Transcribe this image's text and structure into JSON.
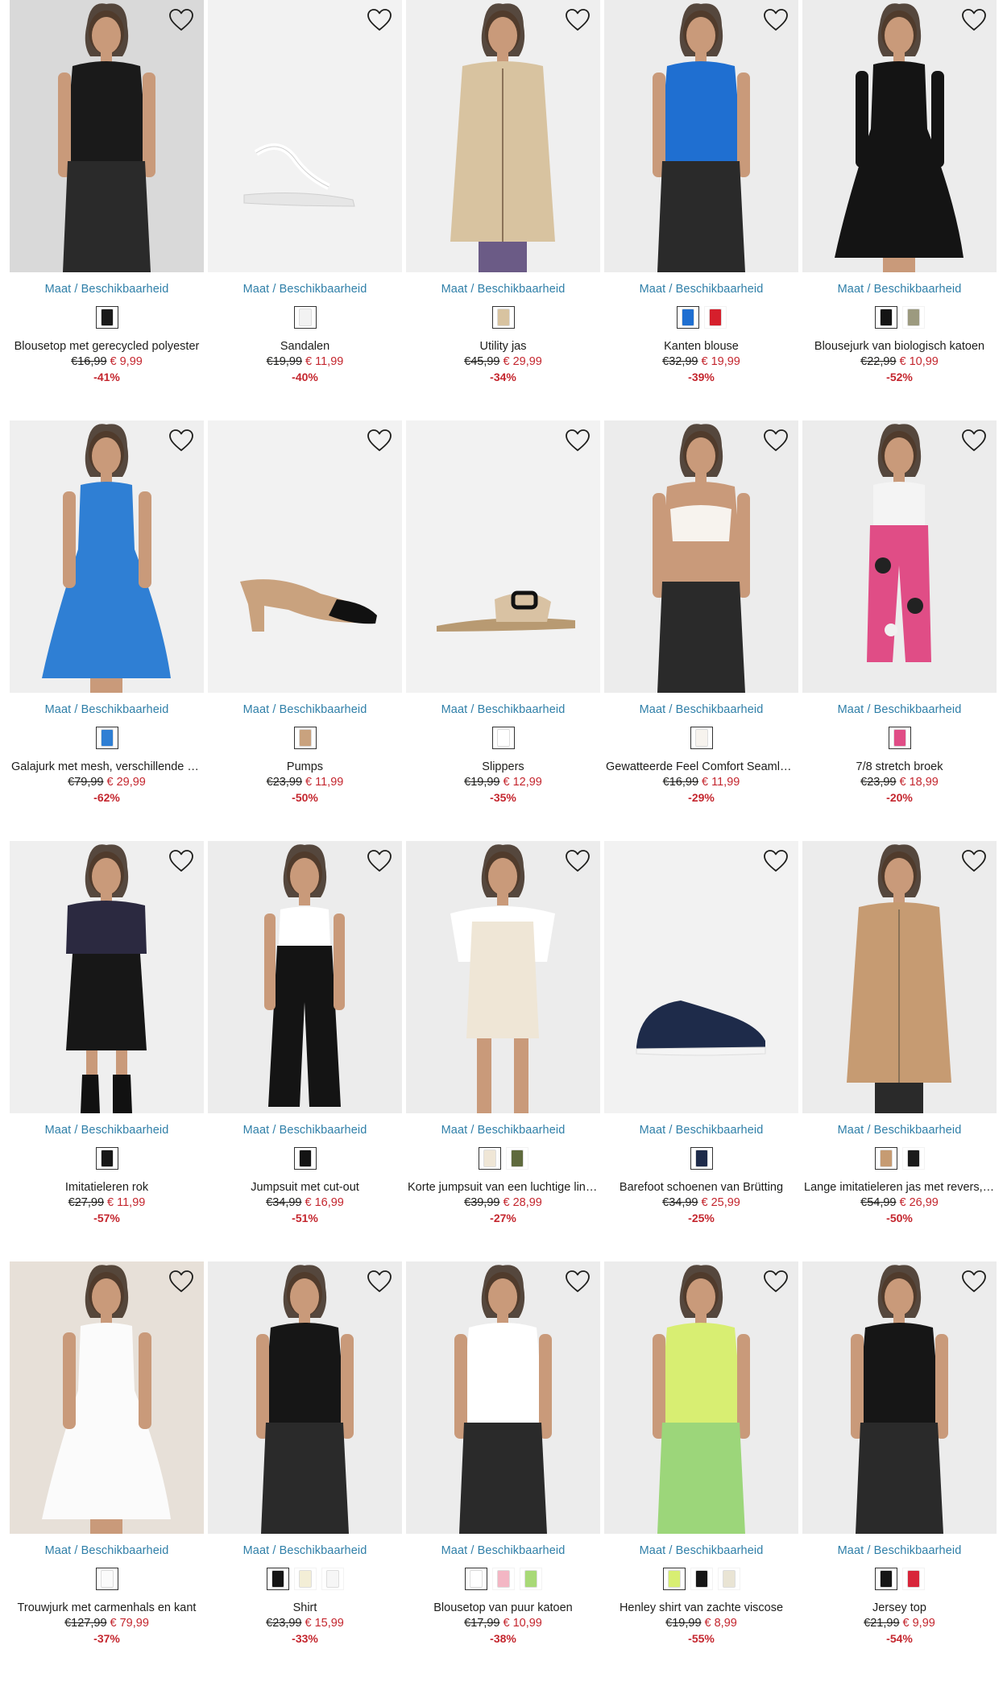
{
  "favorite_label": "♡",
  "products": [
    {
      "availability": "Maat / Beschikbaarheid",
      "name": "Blousetop met gerecycled polyester",
      "old_price": "€16,99",
      "new_price": "€ 9,99",
      "discount": "-41%",
      "bg": "#d9d9d9",
      "garment": "#1a1a1a",
      "kind": "top-model",
      "swatches": [
        "#1a1a1a"
      ]
    },
    {
      "availability": "Maat / Beschikbaarheid",
      "name": "Sandalen",
      "old_price": "€19,99",
      "new_price": "€ 11,99",
      "discount": "-40%",
      "bg": "#f2f2f2",
      "garment": "#ffffff",
      "kind": "sandal",
      "swatches": [
        "#f2f2f2"
      ]
    },
    {
      "availability": "Maat / Beschikbaarheid",
      "name": "Utility jas",
      "old_price": "€45,99",
      "new_price": "€ 29,99",
      "discount": "-34%",
      "bg": "#efefef",
      "garment": "#d8c3a0",
      "kind": "coat-model",
      "swatches": [
        "#d8c3a0"
      ]
    },
    {
      "availability": "Maat / Beschikbaarheid",
      "name": "Kanten blouse",
      "old_price": "€32,99",
      "new_price": "€ 19,99",
      "discount": "-39%",
      "bg": "#ececec",
      "garment": "#1f6fd1",
      "kind": "top-model",
      "swatches": [
        "#1f6fd1",
        "#d61f2c"
      ]
    },
    {
      "availability": "Maat / Beschikbaarheid",
      "name": "Blousejurk van biologisch katoen",
      "old_price": "€22,99",
      "new_price": "€ 10,99",
      "discount": "-52%",
      "bg": "#ececec",
      "garment": "#141414",
      "kind": "dress-model",
      "swatches": [
        "#141414",
        "#9c9a7f"
      ]
    },
    {
      "availability": "Maat / Beschikbaarheid",
      "name": "Galajurk met mesh, verschillende draagwijzen",
      "old_price": "€79,99",
      "new_price": "€ 29,99",
      "discount": "-62%",
      "bg": "#efefef",
      "garment": "#2f7fd4",
      "kind": "gown-model",
      "swatches": [
        "#2f7fd4"
      ]
    },
    {
      "availability": "Maat / Beschikbaarheid",
      "name": "Pumps",
      "old_price": "€23,99",
      "new_price": "€ 11,99",
      "discount": "-50%",
      "bg": "#f2f2f2",
      "garment": "#c9a27e",
      "kind": "pump",
      "swatches": [
        "#c9a27e"
      ]
    },
    {
      "availability": "Maat / Beschikbaarheid",
      "name": "Slippers",
      "old_price": "€19,99",
      "new_price": "€ 12,99",
      "discount": "-35%",
      "bg": "#f2f2f2",
      "garment": "#d9c2a3",
      "kind": "slipper",
      "swatches": [
        "#ffffff"
      ]
    },
    {
      "availability": "Maat / Beschikbaarheid",
      "name": "Gewatteerde Feel Comfort Seamless bralette",
      "old_price": "€16,99",
      "new_price": "€ 11,99",
      "discount": "-29%",
      "bg": "#ececec",
      "garment": "#f7f3ee",
      "kind": "bra-model",
      "swatches": [
        "#f7f3ee"
      ]
    },
    {
      "availability": "Maat / Beschikbaarheid",
      "name": "7/8 stretch broek",
      "old_price": "€23,99",
      "new_price": "€ 18,99",
      "discount": "-20%",
      "bg": "#ececec",
      "garment": "#e04d86",
      "kind": "pants-model",
      "swatches": [
        "#e04d86"
      ]
    },
    {
      "availability": "Maat / Beschikbaarheid",
      "name": "Imitatieleren rok",
      "old_price": "€27,99",
      "new_price": "€ 11,99",
      "discount": "-57%",
      "bg": "#efefef",
      "garment": "#171717",
      "kind": "skirt-model",
      "swatches": [
        "#171717"
      ]
    },
    {
      "availability": "Maat / Beschikbaarheid",
      "name": "Jumpsuit met cut-out",
      "old_price": "€34,99",
      "new_price": "€ 16,99",
      "discount": "-51%",
      "bg": "#ececec",
      "garment": "#141414",
      "kind": "jumpsuit-model",
      "swatches": [
        "#141414"
      ]
    },
    {
      "availability": "Maat / Beschikbaarheid",
      "name": "Korte jumpsuit van een luchtige linnen mix",
      "old_price": "€39,99",
      "new_price": "€ 28,99",
      "discount": "-27%",
      "bg": "#ececec",
      "garment": "#efe6d6",
      "kind": "romper-model",
      "swatches": [
        "#efe6d6",
        "#5f6a3d"
      ]
    },
    {
      "availability": "Maat / Beschikbaarheid",
      "name": "Barefoot schoenen van Brütting",
      "old_price": "€34,99",
      "new_price": "€ 25,99",
      "discount": "-25%",
      "bg": "#f2f2f2",
      "garment": "#1e2b4a",
      "kind": "sneaker",
      "swatches": [
        "#1e2b4a"
      ]
    },
    {
      "availability": "Maat / Beschikbaarheid",
      "name": "Lange imitatieleren jas met revers, oversized",
      "old_price": "€54,99",
      "new_price": "€ 26,99",
      "discount": "-50%",
      "bg": "#ececec",
      "garment": "#c69b72",
      "kind": "longcoat-model",
      "swatches": [
        "#c69b72",
        "#1a1a1a"
      ]
    },
    {
      "availability": "Maat / Beschikbaarheid",
      "name": "Trouwjurk met carmenhals en kant",
      "old_price": "€127,99",
      "new_price": "€ 79,99",
      "discount": "-37%",
      "bg": "#e7e0d8",
      "garment": "#fbfbfb",
      "kind": "gown-model",
      "swatches": [
        "#fbfbfb"
      ]
    },
    {
      "availability": "Maat / Beschikbaarheid",
      "name": "Shirt",
      "old_price": "€23,99",
      "new_price": "€ 15,99",
      "discount": "-33%",
      "bg": "#ececec",
      "garment": "#161616",
      "kind": "top-model",
      "swatches": [
        "#161616",
        "#f3eed6",
        "#f6f6f6"
      ]
    },
    {
      "availability": "Maat / Beschikbaarheid",
      "name": "Blousetop van puur katoen",
      "old_price": "€17,99",
      "new_price": "€ 10,99",
      "discount": "-38%",
      "bg": "#ececec",
      "garment": "#ffffff",
      "kind": "blouse-model",
      "swatches": [
        "#ffffff",
        "#f3b6c4",
        "#a8d977"
      ]
    },
    {
      "availability": "Maat / Beschikbaarheid",
      "name": "Henley shirt van zachte viscose",
      "old_price": "€19,99",
      "new_price": "€ 8,99",
      "discount": "-55%",
      "bg": "#ececec",
      "garment": "#d8ee72",
      "kind": "henley-model",
      "swatches": [
        "#d8ee72",
        "#161616",
        "#e9e4d4"
      ]
    },
    {
      "availability": "Maat / Beschikbaarheid",
      "name": "Jersey top",
      "old_price": "€21,99",
      "new_price": "€ 9,99",
      "discount": "-54%",
      "bg": "#ececec",
      "garment": "#161616",
      "kind": "top-model",
      "swatches": [
        "#161616",
        "#d8253a"
      ]
    }
  ]
}
